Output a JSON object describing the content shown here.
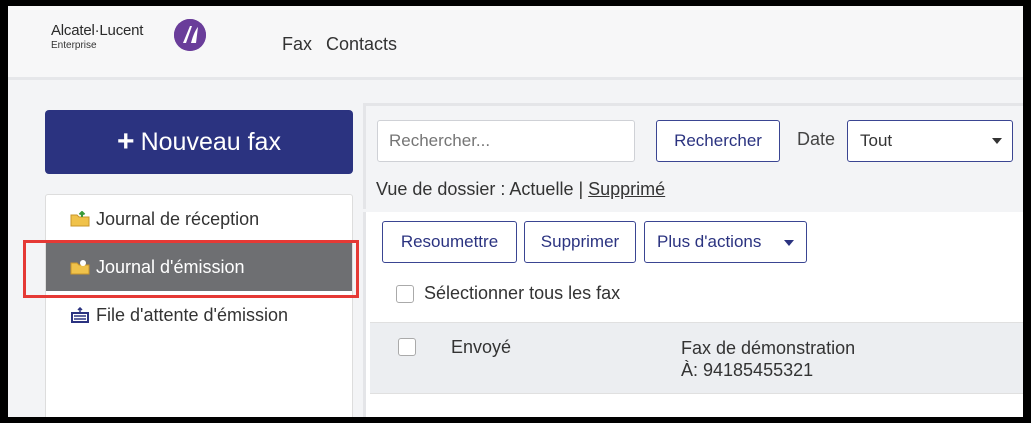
{
  "brand": {
    "name": "Alcatel·Lucent",
    "sub": "Enterprise",
    "logo_icon": "alcatel-lucent-logo"
  },
  "nav": {
    "items": [
      "Fax",
      "Contacts"
    ]
  },
  "sidebar": {
    "new_fax": {
      "plus": "+",
      "label": "Nouveau fax"
    },
    "items": [
      {
        "label": "Journal de réception",
        "icon": "folder-inbox-icon",
        "active": false
      },
      {
        "label": "Journal d'émission",
        "icon": "folder-outbox-icon",
        "active": true
      },
      {
        "label": "File d'attente d'émission",
        "icon": "queue-icon",
        "active": false
      }
    ]
  },
  "search": {
    "placeholder": "Rechercher...",
    "button": "Rechercher"
  },
  "date": {
    "label": "Date",
    "value": "Tout"
  },
  "folder_view": {
    "prefix": "Vue de dossier : Actuelle | ",
    "link": "Supprimé"
  },
  "actions": {
    "resubmit": "Resoumettre",
    "delete": "Supprimer",
    "more": "Plus d'actions"
  },
  "select_all": "Sélectionner tous les fax",
  "fax_rows": [
    {
      "status": "Envoyé",
      "subject": "Fax de démonstration",
      "to": "À: 94185455321"
    }
  ],
  "colors": {
    "primary": "#2b3380",
    "active_item": "#6e6f72",
    "highlight": "#e53935",
    "logo": "#6a3d9a"
  }
}
